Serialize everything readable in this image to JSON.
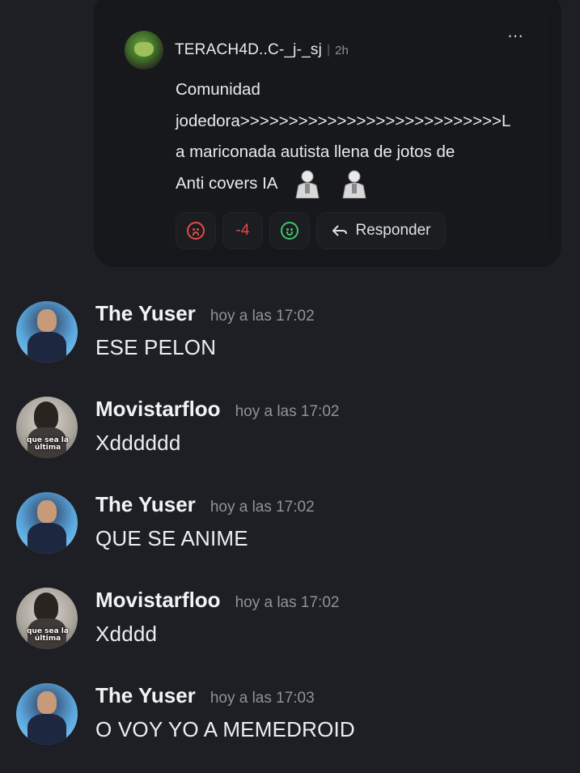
{
  "embed": {
    "author": "TERACH4D..C-_j-_sj",
    "separator": "|",
    "time": "2h",
    "more_icon": "⋯",
    "body_lines": [
      "Comunidad",
      "jodedora>>>>>>>>>>>>>>>>>>>>>>>>>>>L",
      "a mariconada autista llena de jotos de",
      "Anti covers IA"
    ],
    "score": "-4",
    "reply_label": "Responder"
  },
  "messages": [
    {
      "author": "The Yuser",
      "time": "hoy a las 17:02",
      "text": "ESE PELON",
      "avatar": "yuser"
    },
    {
      "author": "Movistarfloo",
      "time": "hoy a las 17:02",
      "text": "Xdddddd",
      "avatar": "movi",
      "avatar_caption": "que sea la última"
    },
    {
      "author": "The Yuser",
      "time": "hoy a las 17:02",
      "text": "QUE SE ANIME",
      "avatar": "yuser"
    },
    {
      "author": "Movistarfloo",
      "time": "hoy a las 17:02",
      "text": "Xdddd",
      "avatar": "movi",
      "avatar_caption": "que sea la última"
    },
    {
      "author": "The Yuser",
      "time": "hoy a las 17:03",
      "text": "O VOY YO A MEMEDROID",
      "avatar": "yuser"
    }
  ],
  "colors": {
    "background": "#1e1f24",
    "downvote": "#e54a4a",
    "upvote": "#3cc36a",
    "score": "#e5484d"
  }
}
